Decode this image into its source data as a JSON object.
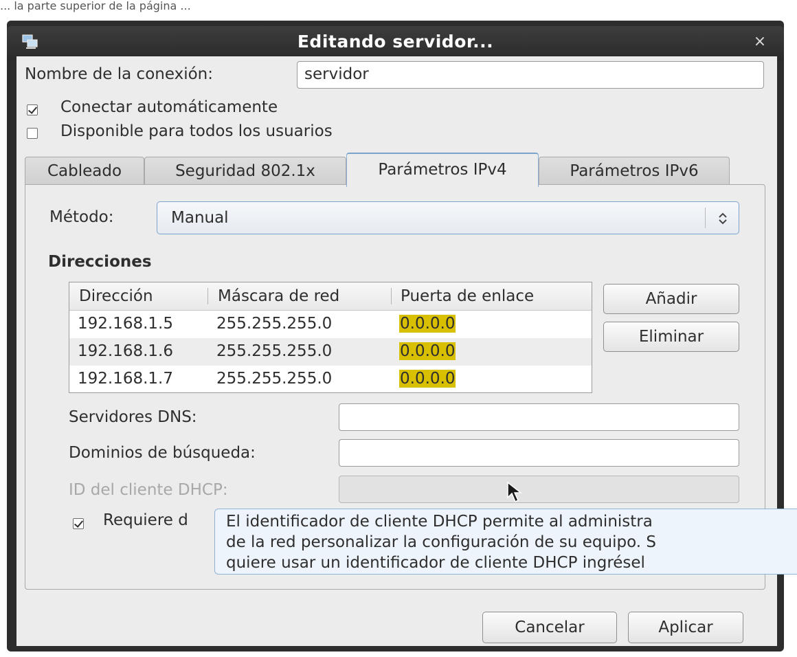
{
  "caption": "... la parte superior de la página ...",
  "window": {
    "title": "Editando servidor...",
    "close_glyph": "×"
  },
  "connection": {
    "name_label": "Nombre de la conexión:",
    "name_value": "servidor",
    "auto_connect_label": "Conectar automáticamente",
    "auto_connect_checked": true,
    "all_users_label": "Disponible para todos los usuarios",
    "all_users_checked": false
  },
  "tabs": [
    {
      "label": "Cableado",
      "active": false
    },
    {
      "label": "Seguridad 802.1x",
      "active": false
    },
    {
      "label": "Parámetros IPv4",
      "active": true
    },
    {
      "label": "Parámetros IPv6",
      "active": false
    }
  ],
  "ipv4": {
    "method_label": "Método:",
    "method_value": "Manual",
    "addresses_title": "Direcciones",
    "columns": [
      "Dirección",
      "Máscara de red",
      "Puerta de enlace"
    ],
    "rows": [
      [
        "192.168.1.5",
        "255.255.255.0",
        "0.0.0.0"
      ],
      [
        "192.168.1.6",
        "255.255.255.0",
        "0.0.0.0"
      ],
      [
        "192.168.1.7",
        "255.255.255.0",
        "0.0.0.0"
      ]
    ],
    "add_button": "Añadir",
    "remove_button": "Eliminar",
    "dns_label": "Servidores DNS:",
    "dns_value": "",
    "search_label": "Dominios de búsqueda:",
    "search_value": "",
    "dhcp_id_label": "ID del cliente DHCP:",
    "dhcp_id_value": "",
    "require_label": "Requiere d",
    "require_checked": true
  },
  "tooltip": {
    "line1": "El identificador de cliente DHCP permite al administra",
    "line2": "de la red personalizar la configuración de su equipo. S",
    "line3": "quiere usar un identificador de cliente DHCP ingrésel"
  },
  "buttons": {
    "cancel": "Cancelar",
    "apply": "Aplicar"
  },
  "colors": {
    "titlebar": "#2d2d2d",
    "dialog_bg": "#ececec",
    "gateway_highlight": "#d8c000",
    "focus_accent": "#7aa3cc"
  },
  "icons": [
    "network-connection-icon",
    "close-icon",
    "combo-arrows-icon",
    "checkmark-icon",
    "mouse-pointer-icon"
  ]
}
